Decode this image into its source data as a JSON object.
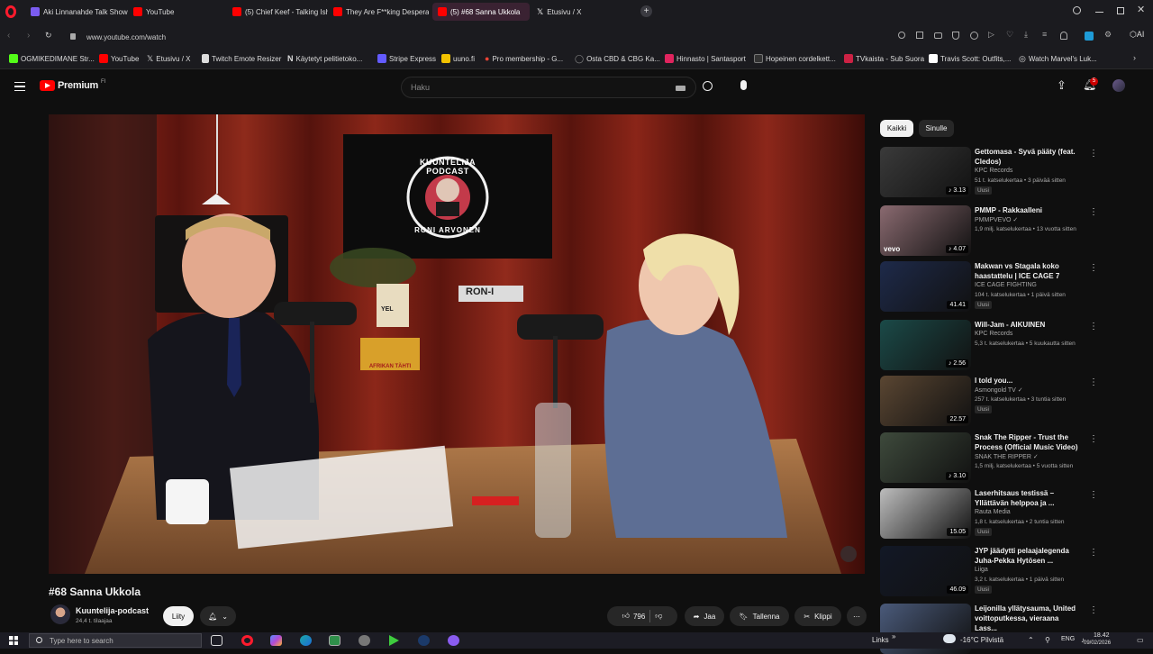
{
  "browser": {
    "tabs": [
      {
        "label": "Aki Linnanahde Talk Show",
        "color": "#7b5cf0"
      },
      {
        "label": "YouTube",
        "color": "#ff0000"
      },
      {
        "label": "(5) Chief Keef - Talking Ish",
        "color": "#ff0000"
      },
      {
        "label": "They Are F**king Desperate",
        "color": "#ff0000"
      },
      {
        "label": "(5) #68 Sanna Ukkola",
        "color": "#ff0000",
        "active": true
      },
      {
        "label": "Etusivu / X",
        "color": "#ffffff"
      }
    ],
    "new_tab": "+",
    "url": "www.youtube.com/watch",
    "bookmarks": [
      {
        "label": "OGMIKEDIMANE Str...",
        "color": "#53fc18"
      },
      {
        "label": "YouTube",
        "color": "#ff0000"
      },
      {
        "label": "Etusivu / X",
        "color": "#ffffff"
      },
      {
        "label": "Twitch Emote Resizer",
        "color": "#dddddd"
      },
      {
        "label": "Käytetyt pelitietoko...",
        "color": "#ffffff"
      },
      {
        "label": "Stripe Express",
        "color": "#635bff"
      },
      {
        "label": "uuno.fi",
        "color": "#f2c200"
      },
      {
        "label": "Pro membership - G...",
        "color": "#ea4335"
      },
      {
        "label": "Osta CBD & CBG Ka...",
        "color": "#888888"
      },
      {
        "label": "Hinnasto | Santasport",
        "color": "#e0245e"
      },
      {
        "label": "Hopeinen cordelkett...",
        "color": "#333333"
      },
      {
        "label": "TVkaista - Sub Suora",
        "color": "#cc2244"
      },
      {
        "label": "Travis Scott: Outfits,...",
        "color": "#ffffff"
      },
      {
        "label": "Watch Marvel's Luk...",
        "color": "#dddddd"
      }
    ]
  },
  "youtube": {
    "logo_text": "Premium",
    "logo_region": "FI",
    "search_placeholder": "Haku",
    "notification_count": "5"
  },
  "video": {
    "title": "#68 Sanna Ukkola",
    "poster_title": "KUUNTELIJA PODCAST",
    "poster_host": "RONI ARVONEN",
    "mug_sign": "YEL",
    "name_sign": "RON-I",
    "box_label": "AFRIKAN TÄHTI",
    "channel_name": "Kuuntelija-podcast",
    "subscribers": "24,4 t. tilaajaa",
    "join_label": "Liity",
    "likes": "796",
    "share_label": "Jaa",
    "save_label": "Tallenna",
    "clip_label": "Klippi",
    "more_label": "⋯"
  },
  "sidebar": {
    "chips": [
      {
        "label": "Kaikki",
        "active": true
      },
      {
        "label": "Sinulle",
        "active": false
      }
    ],
    "recommendations": [
      {
        "title": "Gettomasa - Syvä pääty (feat. Cledos)",
        "channel": "KPC Records",
        "verified": false,
        "meta": "51 t. katselukertaa • 3 päivää sitten",
        "badge": "Uusi",
        "duration": "3.13",
        "short_icon": true,
        "thumb_color": "#3a3a3a"
      },
      {
        "title": "PMMP - Rakkaalleni",
        "channel": "PMMPVEVO",
        "verified": true,
        "meta": "1,9 milj. katselukertaa • 13 vuotta sitten",
        "badge": "",
        "duration": "4.07",
        "short_icon": true,
        "thumb_color": "#8a6a70",
        "overlay_label": "vevo"
      },
      {
        "title": "Makwan vs Stagala koko haastattelu | ICE CAGE 7",
        "channel": "ICE CAGE FIGHTING",
        "verified": false,
        "meta": "104 t. katselukertaa • 1 päivä sitten",
        "badge": "Uusi",
        "duration": "41.41",
        "short_icon": false,
        "thumb_color": "#1e2a4a"
      },
      {
        "title": "Will-Jam - AIKUINEN",
        "channel": "KPC Records",
        "verified": false,
        "meta": "5,3 t. katselukertaa • 5 kuukautta sitten",
        "badge": "",
        "duration": "2.56",
        "short_icon": true,
        "thumb_color": "#1b4a48"
      },
      {
        "title": "I told you...",
        "channel": "Asmongold TV",
        "verified": true,
        "meta": "257 t. katselukertaa • 3 tuntia sitten",
        "badge": "Uusi",
        "duration": "22.57",
        "short_icon": false,
        "thumb_color": "#5a4632"
      },
      {
        "title": "Snak The Ripper - Trust the Process (Official Music Video)",
        "channel": "SNAK THE RIPPER",
        "verified": true,
        "meta": "1,5 milj. katselukertaa • 5 vuotta sitten",
        "badge": "",
        "duration": "3.10",
        "short_icon": true,
        "thumb_color": "#3e4a3c"
      },
      {
        "title": "Laserhitsaus testissä – Yllättävän helppoa ja ...",
        "channel": "Rauta Media",
        "verified": false,
        "meta": "1,8 t. katselukertaa • 2 tuntia sitten",
        "badge": "Uusi",
        "duration": "15.05",
        "short_icon": false,
        "thumb_color": "#bdbdbd"
      },
      {
        "title": "JYP jäädytti pelaajalegenda Juha-Pekka Hytösen ...",
        "channel": "Liiga",
        "verified": false,
        "meta": "3,2 t. katselukertaa • 1 päivä sitten",
        "badge": "Uusi",
        "duration": "46.09",
        "short_icon": false,
        "thumb_color": "#121826"
      },
      {
        "title": "Leijonilla yllätysauma, United voittoputkessa, vieraana Lass...",
        "channel": "",
        "verified": false,
        "meta": "",
        "badge": "",
        "duration": "",
        "short_icon": false,
        "thumb_color": "#4a5a7a"
      }
    ]
  },
  "taskbar": {
    "search_placeholder": "Type here to search",
    "links_label": "Links",
    "weather": "-16°C  Pilvistä",
    "language": "ENG",
    "time": "18.42",
    "date": "09/02/2026"
  },
  "colors": {
    "yt_red": "#ff0000",
    "curtain": "#7a1c14",
    "active_tab": "#3a2232",
    "chip_active_bg": "#f1f1f1"
  }
}
